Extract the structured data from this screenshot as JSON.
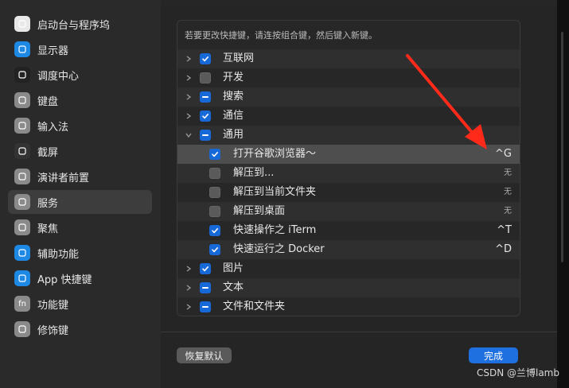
{
  "sidebar": {
    "items": [
      {
        "label": "启动台与程序坞",
        "icon": "launchpad-icon",
        "color": "#e8e8e8"
      },
      {
        "label": "显示器",
        "icon": "display-icon",
        "color": "#1e88e5"
      },
      {
        "label": "调度中心",
        "icon": "mission-control-icon",
        "color": "#222222"
      },
      {
        "label": "键盘",
        "icon": "keyboard-icon",
        "color": "#8a8a8a"
      },
      {
        "label": "输入法",
        "icon": "input-method-icon",
        "color": "#8a8a8a"
      },
      {
        "label": "截屏",
        "icon": "screenshot-icon",
        "color": "#333333"
      },
      {
        "label": "演讲者前置",
        "icon": "presenter-icon",
        "color": "#8a8a8a"
      },
      {
        "label": "服务",
        "icon": "services-icon",
        "color": "#8a8a8a"
      },
      {
        "label": "聚焦",
        "icon": "spotlight-icon",
        "color": "#8a8a8a"
      },
      {
        "label": "辅助功能",
        "icon": "accessibility-icon",
        "color": "#1e88e5"
      },
      {
        "label": "App 快捷键",
        "icon": "app-shortcuts-icon",
        "color": "#1e88e5"
      },
      {
        "label": "功能键",
        "icon": "function-key-icon",
        "color": "#8a8a8a"
      },
      {
        "label": "修饰键",
        "icon": "modifier-key-icon",
        "color": "#8a8a8a"
      }
    ],
    "selected_index": 7,
    "fn_glyph": "fn"
  },
  "panel": {
    "hint": "若要更改快捷键，请连按组合键，然后键入新键。",
    "rows": [
      {
        "label": "互联网",
        "level": 0,
        "state": "checked",
        "expand": "collapsed",
        "shortcut": ""
      },
      {
        "label": "开发",
        "level": 0,
        "state": "unchecked",
        "expand": "collapsed",
        "shortcut": ""
      },
      {
        "label": "搜索",
        "level": 0,
        "state": "mixed",
        "expand": "collapsed",
        "shortcut": ""
      },
      {
        "label": "通信",
        "level": 0,
        "state": "checked",
        "expand": "collapsed",
        "shortcut": ""
      },
      {
        "label": "通用",
        "level": 0,
        "state": "mixed",
        "expand": "expanded",
        "shortcut": ""
      },
      {
        "label": "打开谷歌浏览器～",
        "level": 1,
        "state": "checked",
        "expand": "none",
        "shortcut": "^G",
        "highlight": true
      },
      {
        "label": "解压到...",
        "level": 1,
        "state": "unchecked",
        "expand": "none",
        "shortcut": "无"
      },
      {
        "label": "解压到当前文件夹",
        "level": 1,
        "state": "unchecked",
        "expand": "none",
        "shortcut": "无"
      },
      {
        "label": "解压到桌面",
        "level": 1,
        "state": "unchecked",
        "expand": "none",
        "shortcut": "无"
      },
      {
        "label": "快速操作之 iTerm",
        "level": 1,
        "state": "checked",
        "expand": "none",
        "shortcut": "^T"
      },
      {
        "label": "快速运行之 Docker",
        "level": 1,
        "state": "checked",
        "expand": "none",
        "shortcut": "^D"
      },
      {
        "label": "图片",
        "level": 0,
        "state": "checked",
        "expand": "collapsed",
        "shortcut": ""
      },
      {
        "label": "文本",
        "level": 0,
        "state": "mixed",
        "expand": "collapsed",
        "shortcut": ""
      },
      {
        "label": "文件和文件夹",
        "level": 0,
        "state": "mixed",
        "expand": "collapsed",
        "shortcut": ""
      }
    ]
  },
  "buttons": {
    "restore": "恢复默认",
    "done": "完成"
  },
  "watermark": "CSDN @兰博lamb",
  "colors": {
    "accent": "#1e6fe0",
    "annotation_arrow": "#ff2a1a"
  }
}
